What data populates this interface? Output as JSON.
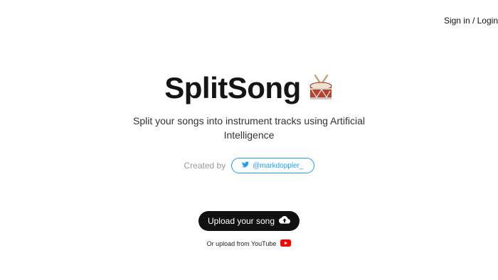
{
  "header": {
    "signin_label": "Sign in / Login"
  },
  "hero": {
    "title": "SplitSong",
    "title_icon": "drum-icon",
    "subtitle": "Split your songs into instrument tracks using Artificial Intelligence",
    "created_by_label": "Created by",
    "twitter_handle": "@markdoppler_",
    "twitter_icon": "twitter-bird-icon"
  },
  "actions": {
    "upload_label": "Upload your song",
    "upload_icon": "cloud-upload-icon",
    "youtube_label": "Or upload from YouTube",
    "youtube_icon": "youtube-icon"
  },
  "colors": {
    "accent_twitter": "#1da1f2",
    "button_bg": "#111111",
    "youtube_red": "#ff0000"
  }
}
